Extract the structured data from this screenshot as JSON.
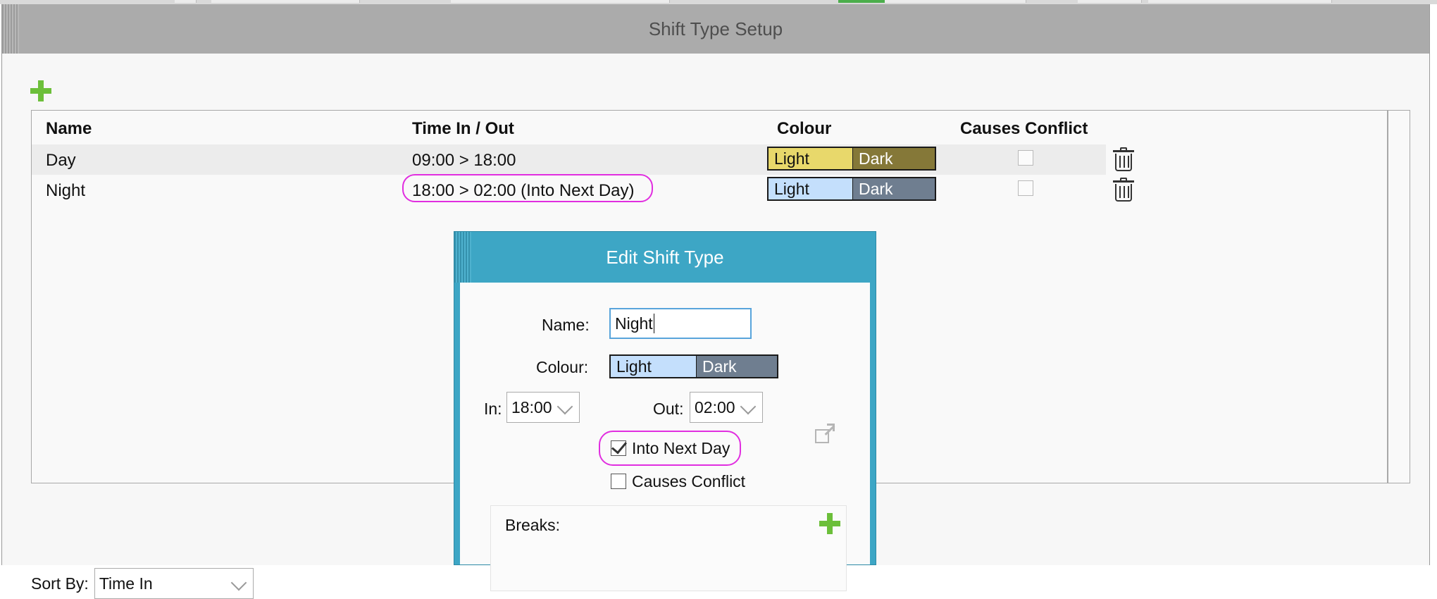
{
  "window": {
    "title": "Shift Type Setup"
  },
  "grid": {
    "columns": {
      "name": "Name",
      "time": "Time In / Out",
      "colour": "Colour",
      "conflict": "Causes Conflict"
    },
    "rows": [
      {
        "name": "Day",
        "time": "09:00 > 18:00",
        "light_label": "Light",
        "dark_label": "Dark",
        "light_color": "#e8d86b",
        "dark_color": "#857838",
        "causes_conflict": false
      },
      {
        "name": "Night",
        "time": "18:00 > 02:00 (Into Next Day)",
        "light_label": "Light",
        "dark_label": "Dark",
        "light_color": "#c4dffc",
        "dark_color": "#6f7e90",
        "causes_conflict": false
      }
    ]
  },
  "sort": {
    "label": "Sort By:",
    "value": "Time In"
  },
  "dialog": {
    "title": "Edit Shift Type",
    "name_label": "Name:",
    "name_value": "Night",
    "colour_label": "Colour:",
    "light_label": "Light",
    "dark_label": "Dark",
    "in_label": "In:",
    "in_value": "18:00",
    "out_label": "Out:",
    "out_value": "02:00",
    "into_next_day_label": "Into Next Day",
    "into_next_day_checked": true,
    "causes_conflict_label": "Causes Conflict",
    "causes_conflict_checked": false,
    "breaks_label": "Breaks:"
  },
  "colors": {
    "highlight": "#e12ee0",
    "add_icon": "#6cbf3a",
    "dialog_header": "#3da6c5",
    "titlebar": "#ababab"
  },
  "icons": {
    "add": "plus-icon",
    "delete": "trash-icon",
    "dropdown": "chevron-down-icon",
    "external": "external-link-icon"
  }
}
